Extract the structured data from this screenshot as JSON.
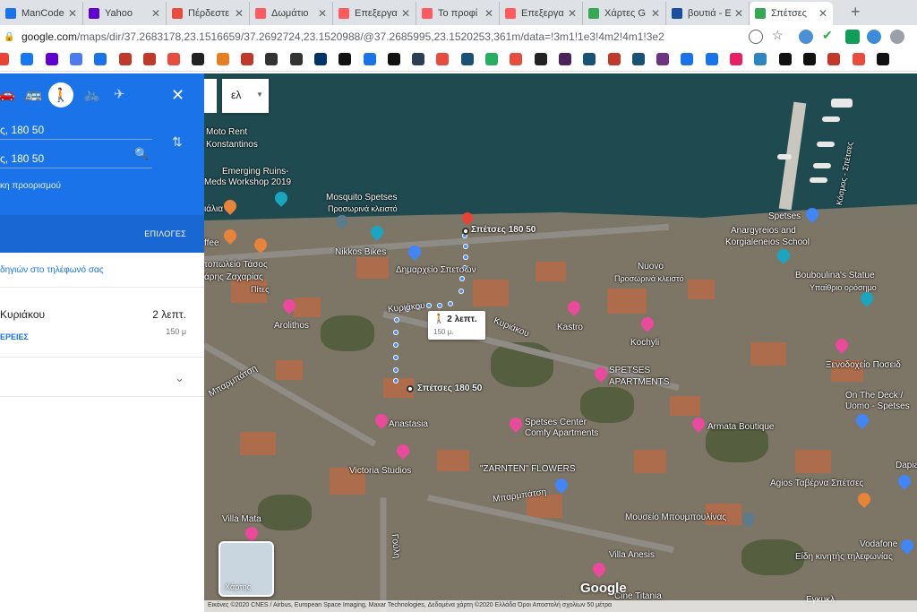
{
  "tabs": [
    {
      "title": "ManCode",
      "color": "#1a73e8",
      "icon": "mancode-icon"
    },
    {
      "title": "Yahoo",
      "color": "#6001d2",
      "icon": "yahoo-icon"
    },
    {
      "title": "Πέρδεστε",
      "color": "#e94b3c",
      "icon": "p-icon"
    },
    {
      "title": "Δωμάτιο",
      "color": "#ff5a5f",
      "icon": "airbnb-icon"
    },
    {
      "title": "Επεξεργα",
      "color": "#ff5a5f",
      "icon": "airbnb-icon"
    },
    {
      "title": "Το προφί",
      "color": "#ff5a5f",
      "icon": "airbnb-icon"
    },
    {
      "title": "Επεξεργα",
      "color": "#ff5a5f",
      "icon": "airbnb-icon"
    },
    {
      "title": "Χάρτες G",
      "color": "#34a853",
      "icon": "maps-icon"
    },
    {
      "title": "βουτιά - E",
      "color": "#1a4fa0",
      "icon": "wr-icon"
    },
    {
      "title": "Σπέτσες",
      "color": "#34a853",
      "icon": "maps-icon"
    }
  ],
  "address": {
    "host": "google.com",
    "path": "/maps/dir/37.2683178,23.1516659/37.2692724,23.1520988/@37.2685995,23.1520253,361m/data=!3m1!1e3!4m2!4m1!3e2"
  },
  "bookmark_colors": [
    "#ea4335",
    "#1877f2",
    "#6001d2",
    "#4b7bec",
    "#1a73e8",
    "#c0392b",
    "#c0392b",
    "#e74c3c",
    "#222",
    "#e67e22",
    "#c0392b",
    "#333",
    "#333",
    "#003366",
    "#111",
    "#1a73e8",
    "#111",
    "#2c3e50",
    "#e74c3c",
    "#1a5276",
    "#27ae60",
    "#e74c3c",
    "#222",
    "#4a235a",
    "#1a5276",
    "#c0392b",
    "#1a5276",
    "#6c3483",
    "#1a73e8",
    "#1a73e8",
    "#e91e63",
    "#2e86c1",
    "#111",
    "#111",
    "#c0392b",
    "#e74c3c",
    "#111"
  ],
  "panel": {
    "from": "ς, 180 50",
    "to": "ς, 180 50",
    "add_destination": "κη προορισμού",
    "options_label": "ΕΠΙΛΟΓΕΣ",
    "send_to_phone": "δηγιών στο τηλέφωνό σας",
    "route_name": "Κυριάκου",
    "route_time": "2 λεπτ.",
    "route_distance": "150 μ",
    "route_details": "ΕΡΕΙΕΣ"
  },
  "map": {
    "lang_selector": "ελ",
    "walk_time": "2 λεπτ.",
    "walk_distance": "150 μ.",
    "dest_label": "Σπέτσες 180 50",
    "origin_label": "Σπέτσες 180 50",
    "satellite_toggle": "Χάρτης",
    "google_logo": "Google",
    "attribution": "Εικόνες ©2020 CNES / Airbus, European Space Imaging, Maxar Technologies, Δεδομένα χάρτη ©2020     Ελλάδα   Όροι   Αποστολή σχολίων   50 μέτρα",
    "labels": {
      "moto": "Moto Rent",
      "konst": "Konstantinos",
      "emerging": "Emerging Ruins-",
      "meds": "Meds Workshop 2019",
      "mosquito": "Mosquito Spetses",
      "mosquito_sub": "Προσωρινά κλειστό",
      "alia": "ιάλια",
      "ffee": "ffee",
      "nikkos": "Nikkos Bikes",
      "dimarxeio": "Δημαρχείο Σπετσών",
      "taxos": "τοπωλείο Τάσος",
      "zaxaria": "άρης Ζαχαρίας",
      "pites": "Πίτες",
      "arolithos": "Arolithos",
      "kyriakou": "Κυριάκου",
      "kyriakou2": "Κυριάκου",
      "nuovo": "Nuovo",
      "nuovo_sub": "Προσωρινά κλειστό",
      "kastro": "Kastro",
      "kochyli": "Kochyli",
      "spetses": "Spetses",
      "anargyreios": "Anargyreios and",
      "korgialeneios": "Korgialeneios School",
      "kosmos": "Κόσμος - Σπέτσες",
      "bouboulina": "Bouboulina's Statue",
      "bouboulina_sub": "Υπαίθριο ορόσημο",
      "mparmpatsi": "Μπαρμπάτση",
      "mparmpatsi2": "Μπαρμπάτση",
      "spetses_apts": "SPETSES",
      "spetses_apts2": "APARTMENTS",
      "xenodoxeio": "Ξενοδοχείο Ποσειδ",
      "onthedeck": "On The Deck /",
      "uomo": "Uomo - Spetses",
      "anastasia": "Anastasia",
      "spetses_center": "Spetses Center",
      "comfy": "Comfy Apartments",
      "armata": "Armata Boutique",
      "victoria": "Victoria Studios",
      "zarnten": "\"ZARNTEN\" FLOWERS",
      "dapia": "Dapia S",
      "agios": "Agios Ταβέρνα Σπέτσες",
      "villa_mata": "Villa Mata",
      "mouseio": "Μουσείο Μπουμπουλίνας",
      "villa_anesis": "Villa Anesis",
      "cine": "Cine Titania",
      "vodafone": "Vodafone",
      "eidi": "Είδη κινητής τηλεφωνίας",
      "gouli": "Γούλη",
      "egkykl": "Εγκυκλ"
    }
  }
}
